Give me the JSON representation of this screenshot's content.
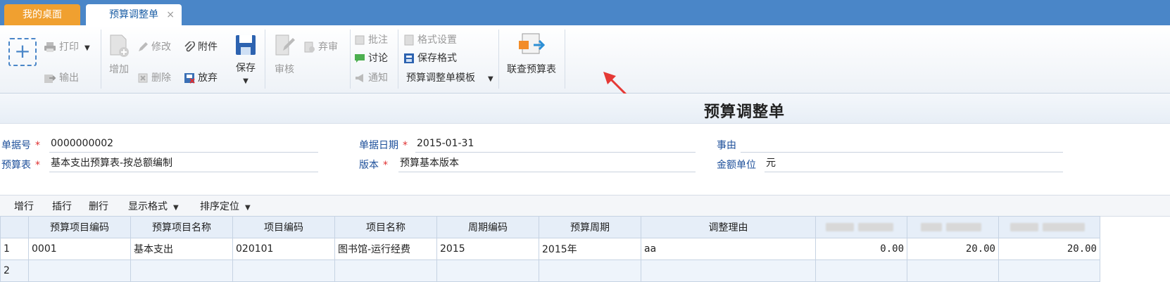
{
  "tabs": {
    "home": "我的桌面",
    "active": "预算调整单",
    "close": "×"
  },
  "toolbar": {
    "print": "打印",
    "export": "输出",
    "add": "增加",
    "edit": "修改",
    "delete": "删除",
    "attach": "附件",
    "discard": "放弃",
    "save": "保存",
    "audit": "审核",
    "abandon": "弃审",
    "annotate": "批注",
    "discuss": "讨论",
    "notify": "通知",
    "format_settings": "格式设置",
    "save_format": "保存格式",
    "template": "预算调整单模板",
    "linked_query": "联查预算表"
  },
  "page_title": "预算调整单",
  "form": {
    "doc_no_label": "单据号",
    "doc_no": "0000000002",
    "date_label": "单据日期",
    "date": "2015-01-31",
    "reason_label": "事由",
    "reason": "",
    "budget_label": "预算表",
    "budget": "基本支出预算表-按总额编制",
    "version_label": "版本",
    "version": "预算基本版本",
    "unit_label": "金额单位",
    "unit": "元"
  },
  "grid_toolbar": {
    "add_row": "增行",
    "insert_row": "插行",
    "delete_row": "删行",
    "display_format": "显示格式",
    "sort_locate": "排序定位"
  },
  "table": {
    "headers": [
      "预算项目编码",
      "预算项目名称",
      "项目编码",
      "项目名称",
      "周期编码",
      "预算周期",
      "调整理由"
    ],
    "rows": [
      {
        "idx": "1",
        "cells": [
          "0001",
          "基本支出",
          "020101",
          "图书馆-运行经费",
          "2015",
          "2015年",
          "aa"
        ],
        "nums": [
          "0.00",
          "20.00",
          "20.00"
        ]
      },
      {
        "idx": "2",
        "cells": [
          "",
          "",
          "",
          "",
          "",
          "",
          ""
        ],
        "nums": [
          "",
          "",
          ""
        ]
      }
    ]
  },
  "colors": {
    "tabbar": "#4a86c8",
    "home_tab": "#f0a030",
    "label": "#1d4f9a",
    "required": "#e03030",
    "arrow": "#e53935"
  }
}
